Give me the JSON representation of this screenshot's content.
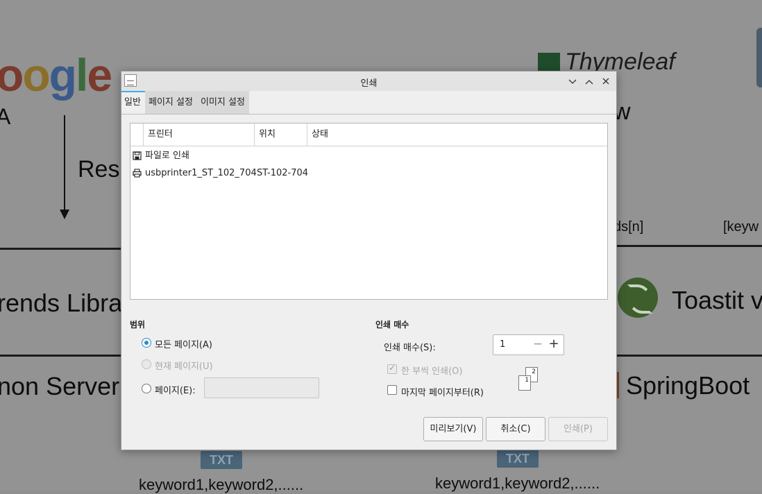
{
  "background": {
    "google_letters": [
      "o",
      "o",
      "g",
      "l",
      "e"
    ],
    "thymeleaf": "Thymeleaf",
    "res_fragment": "Res",
    "a_fragment": "A",
    "w_fragment": "w",
    "trends_fragment": "rends Libra",
    "toastit_fragment": "Toastit v",
    "server_fragment": "non Server",
    "springboot": "SpringBoot",
    "words_fragment": "ds[n]",
    "keyword_fragment": "[keyw",
    "txt_badge": "TXT",
    "keyword_line": "keyword1,keyword2,......"
  },
  "dialog": {
    "title": "인쇄",
    "tabs": [
      "일반",
      "페이지 설정",
      "이미지 설정"
    ],
    "printer_list": {
      "columns": [
        "프린터",
        "위치",
        "상태"
      ],
      "rows": [
        {
          "icon": "floppy-icon",
          "name": "파일로 인쇄",
          "location": "",
          "status": ""
        },
        {
          "icon": "printer-icon",
          "name": "usbprinter1_ST_102_704",
          "location": "ST-102-704",
          "status": ""
        }
      ]
    },
    "range": {
      "heading": "범위",
      "all_pages": "모든 페이지(A)",
      "current_page": "현재 페이지(U)",
      "pages": "페이지(E):",
      "pages_value": ""
    },
    "copies": {
      "heading": "인쇄 매수",
      "label": "인쇄 매수(S):",
      "value": "1",
      "minus": "−",
      "plus": "+",
      "collate": "한 부씩 인쇄(O)",
      "reverse": "마지막 페이지부터(R)",
      "sheet_back": "2",
      "sheet_front": "1"
    },
    "buttons": {
      "preview": "미리보기(V)",
      "cancel": "취소(C)",
      "print": "인쇄(P)"
    }
  }
}
